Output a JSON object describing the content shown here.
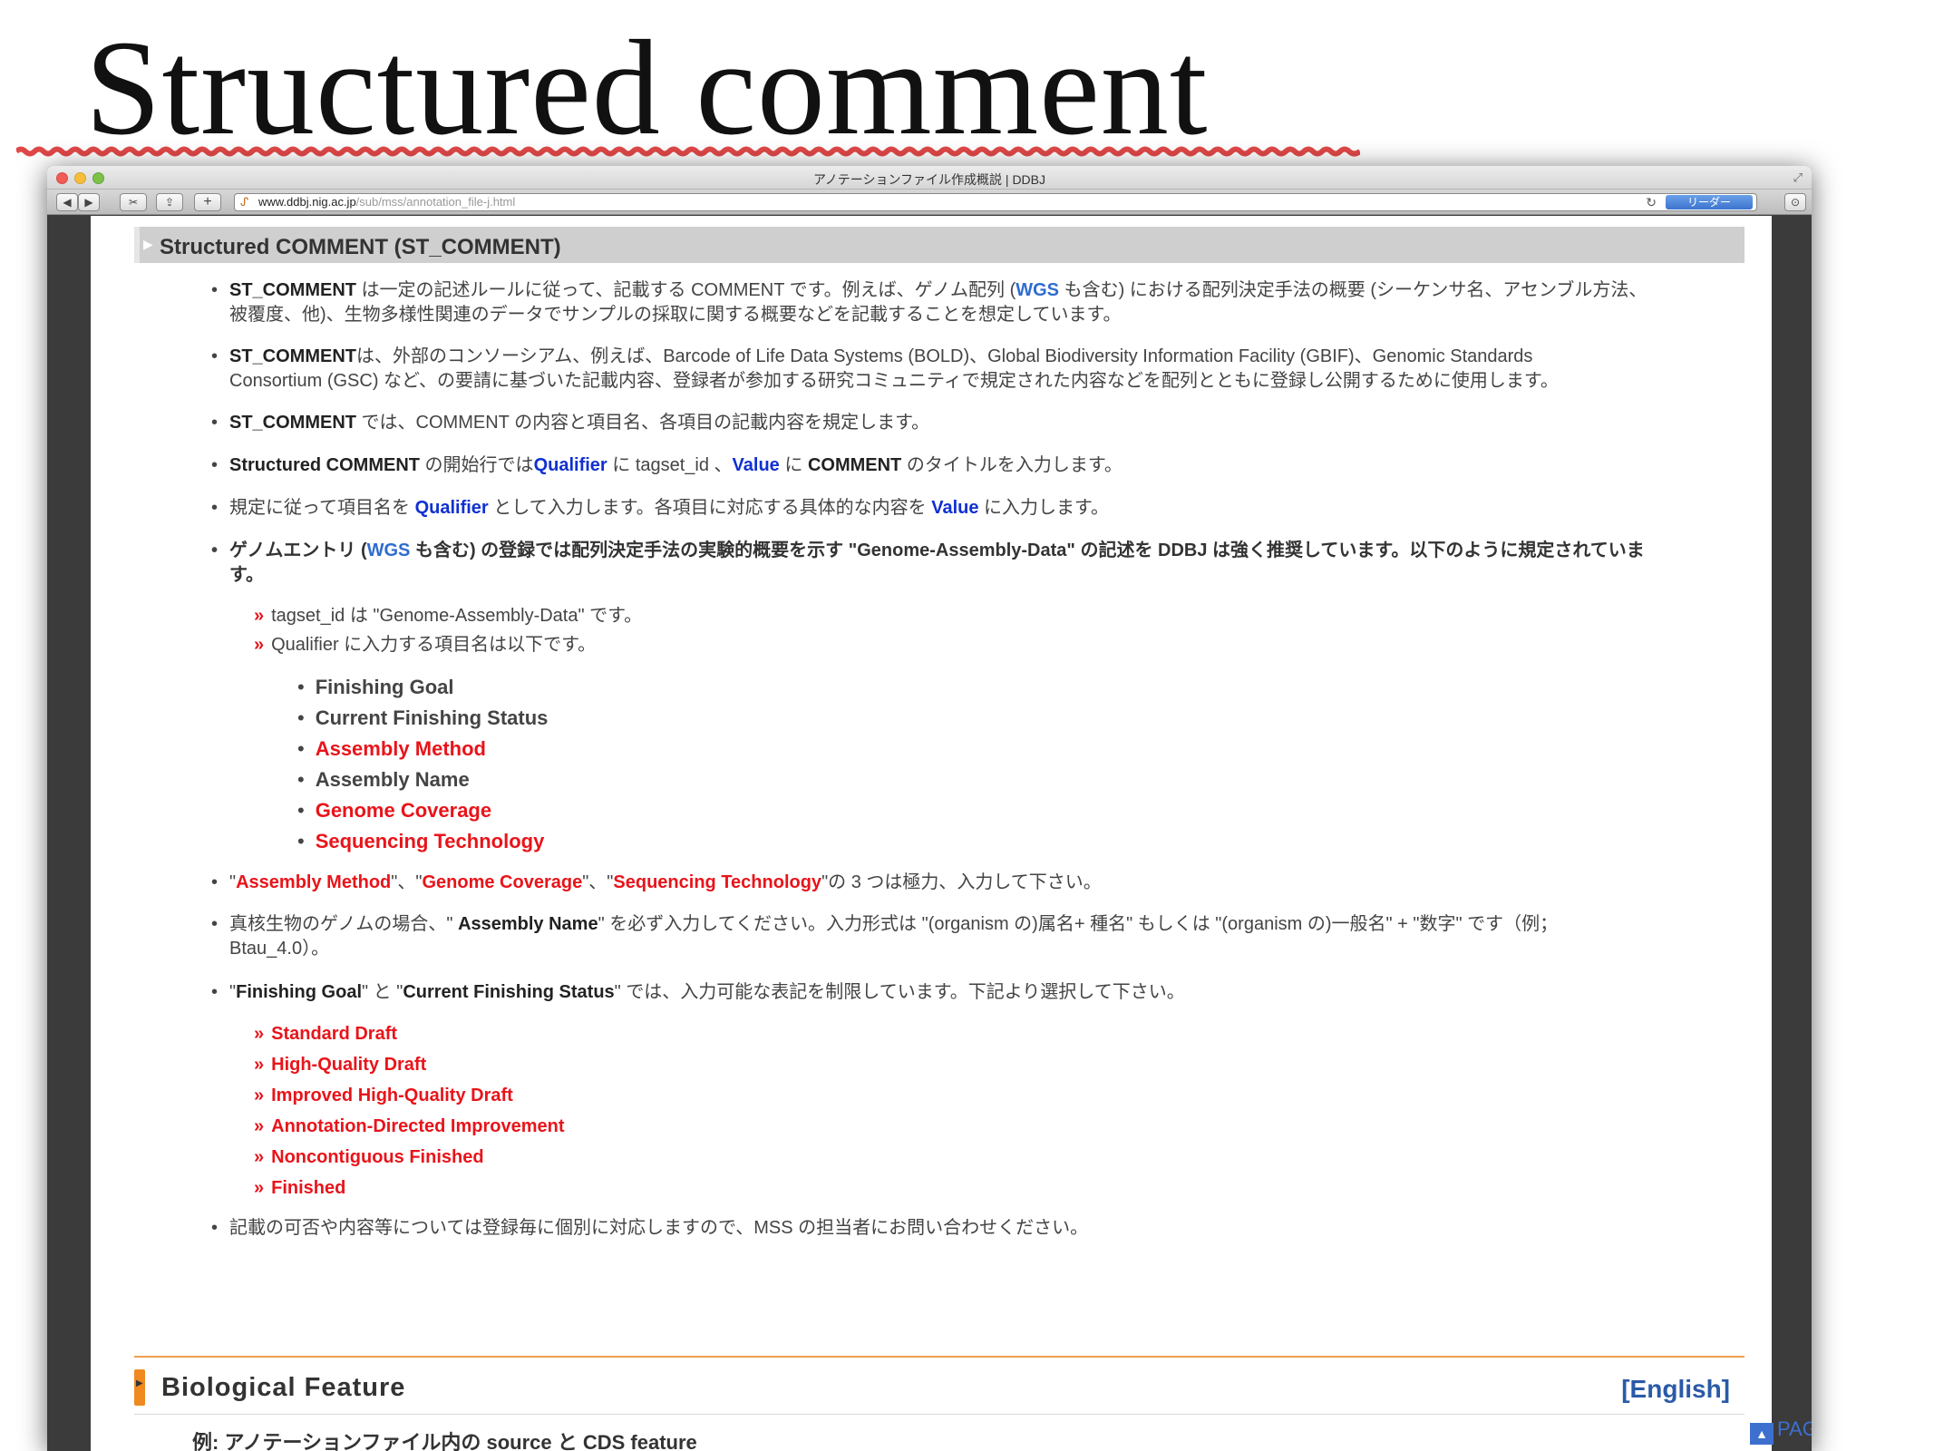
{
  "slide": {
    "title": "Structured comment"
  },
  "browser": {
    "window_title": "アノテーションファイル作成概説 | DDBJ",
    "url_host": "www.ddbj.nig.ac.jp",
    "url_path": "/sub/mss/annotation_file-j.html",
    "reader_label": "リーダー",
    "icons": [
      "back-icon",
      "forward-icon",
      "bookmark-icon",
      "share-icon",
      "new-tab-icon",
      "reload-icon",
      "download-icon",
      "resize-icon"
    ]
  },
  "section": {
    "title": "Structured COMMENT (ST_COMMENT)"
  },
  "bullets": {
    "b1": {
      "term": "ST_COMMENT",
      "pre_wgs": " は一定の記述ルールに従って、記載する COMMENT です。例えば、ゲノム配列 (",
      "wgs": "WGS",
      "post_wgs": " も含む) における配列決定手法の概要 (シーケンサ名、アセンブル方法、",
      "line2": "被覆度、他)、生物多様性関連のデータでサンプルの採取に関する概要などを記載することを想定しています。"
    },
    "b2": {
      "term": "ST_COMMENT",
      "line1": "は、外部のコンソーシアム、例えば、Barcode of Life Data Systems (BOLD)、Global Biodiversity Information Facility (GBIF)、Genomic Standards",
      "line2": "Consortium (GSC) など、の要請に基づいた記載内容、登録者が参加する研究コミュニティで規定された内容などを配列とともに登録し公開するために使用します。"
    },
    "b3": {
      "term": "ST_COMMENT",
      "text": " では、COMMENT の内容と項目名、各項目の記載内容を規定します。"
    },
    "b4": {
      "term": "Structured COMMENT",
      "t1": " の開始行では",
      "qualifier": "Qualifier",
      "t2": " に tagset_id 、",
      "value": "Value",
      "t3": " に ",
      "comment": "COMMENT",
      "t4": " のタイトルを入力します。"
    },
    "b5": {
      "t1": "規定に従って項目名を ",
      "qualifier": "Qualifier",
      "t2": " として入力します。各項目に対応する具体的な内容を ",
      "value": "Value",
      "t3": " に入力します。"
    },
    "b6": {
      "t1": "ゲノムエントリ (",
      "wgs": "WGS",
      "t2": " も含む) の登録では配列決定手法の実験的概要を示す \"Genome-Assembly-Data\" の記述を DDBJ は強く推奨しています。以下のように規定されていま",
      "line2": "す。"
    },
    "b6_sub": [
      {
        "raquo": "»",
        "text": "tagset_id は \"Genome-Assembly-Data\" です。"
      },
      {
        "raquo": "»",
        "text": "Qualifier に入力する項目名は以下です。"
      }
    ],
    "qualifier_items": [
      {
        "bullet": "•",
        "label": "Finishing Goal"
      },
      {
        "bullet": "•",
        "label": "Current Finishing Status"
      },
      {
        "bullet": "•",
        "label": "Assembly Method"
      },
      {
        "bullet": "•",
        "label": "Assembly Name"
      },
      {
        "bullet": "•",
        "label": "Genome Coverage"
      },
      {
        "bullet": "•",
        "label": "Sequencing Technology"
      }
    ],
    "b7": {
      "q1": "\"",
      "am": "Assembly Method",
      "q2": "\"、\"",
      "gc": "Genome Coverage",
      "q3": "\"、\"",
      "st": "Sequencing Technology",
      "q4": "\"の 3 つは極力、入力して下さい。"
    },
    "b8": {
      "t1": "真核生物のゲノムの場合、\" ",
      "term": "Assembly Name",
      "t2": "\" を必ず入力してください。入力形式は \"(organism の)属名+ 種名\" もしくは \"(organism の)一般名\" + \"数字\" です（例；",
      "line2": "Btau_4.0）。"
    },
    "b9": {
      "q1": "\"",
      "fg": "Finishing Goal",
      "t1": "\" と \"",
      "cfs": "Current Finishing Status",
      "t2": "\" では、入力可能な表記を制限しています。下記より選択して下さい。"
    },
    "finishing_options": [
      {
        "raquo": "»",
        "label": "Standard Draft"
      },
      {
        "raquo": "»",
        "label": "High-Quality Draft"
      },
      {
        "raquo": "»",
        "label": "Improved High-Quality Draft"
      },
      {
        "raquo": "»",
        "label": "Annotation-Directed Improvement"
      },
      {
        "raquo": "»",
        "label": "Noncontiguous Finished"
      },
      {
        "raquo": "»",
        "label": "Finished"
      }
    ],
    "b10": {
      "text": "記載の可否や内容等については登録毎に個別に対応しますので、MSS の担当者にお問い合わせください。"
    }
  },
  "bio_section": {
    "title": "Biological Feature",
    "english_link": "[English]",
    "page_top": "PAGE TOP",
    "example": "例: アノテーションファイル内の source と CDS feature"
  },
  "colors": {
    "accent_red": "#e8141a",
    "link_blue": "#1030d0",
    "orange": "#f08a1e",
    "reader_blue": "#3c74cf"
  }
}
